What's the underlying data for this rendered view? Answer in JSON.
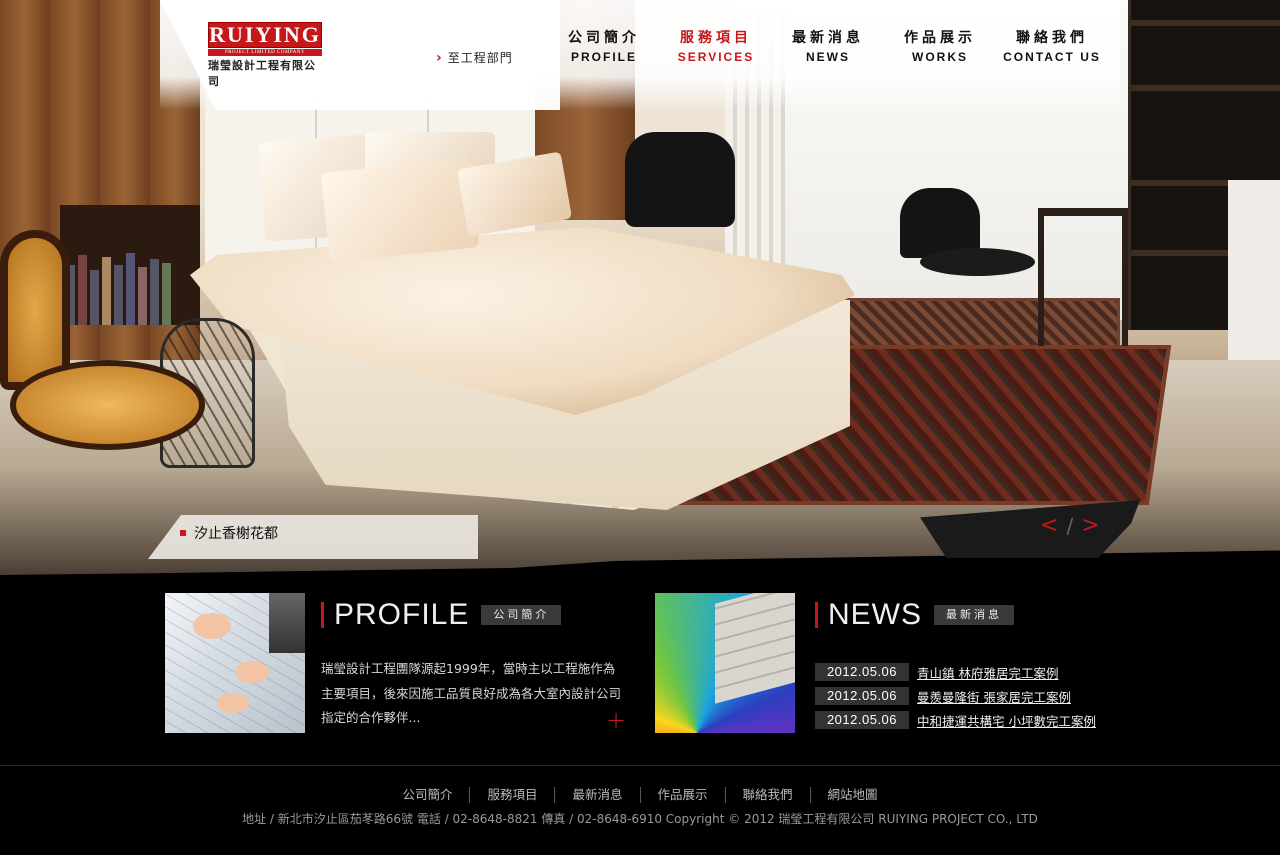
{
  "header": {
    "logo": {
      "mark": "RUIYING",
      "sub": "PROJECT LIMITED COMPANY",
      "cn": "瑞瑩設計工程有限公司"
    },
    "engineering_link": "至工程部門",
    "nav": [
      {
        "zh": "公司簡介",
        "en": "PROFILE",
        "active": false
      },
      {
        "zh": "服務項目",
        "en": "SERVICES",
        "active": true
      },
      {
        "zh": "最新消息",
        "en": "NEWS",
        "active": false
      },
      {
        "zh": "作品展示",
        "en": "WORKS",
        "active": false
      },
      {
        "zh": "聯絡我們",
        "en": "CONTACT US",
        "active": false
      }
    ]
  },
  "hero": {
    "caption": "汐止香榭花都",
    "prev": "<",
    "separator": "/",
    "next": ">"
  },
  "profile": {
    "title_en": "PROFILE",
    "title_badge": "公司簡介",
    "text": "瑞瑩設計工程團隊源起1999年，當時主以工程施作為主要項目，後來因施工品質良好成為各大室內設計公司指定的合作夥伴...",
    "more": "+"
  },
  "news": {
    "title_en": "NEWS",
    "title_badge": "最新消息",
    "items": [
      {
        "date": "2012.05.06",
        "title": "青山鎮 林府雅居完工案例"
      },
      {
        "date": "2012.05.06",
        "title": "曼羨曼隆街 張家居完工案例"
      },
      {
        "date": "2012.05.06",
        "title": "中和捷運共構宅 小坪數完工案例"
      }
    ]
  },
  "footer": {
    "links": [
      "公司簡介",
      "服務項目",
      "最新消息",
      "作品展示",
      "聯絡我們",
      "網站地圖"
    ],
    "info": "地址 / 新北市汐止區茄苳路66號 電話 / 02-8648-8821 傳真 / 02-8648-6910   Copyright © 2012 瑞瑩工程有限公司 RUIYING PROJECT CO., LTD"
  },
  "colors": {
    "accent": "#c6171a",
    "background": "#000000",
    "badge": "#3a3a3a"
  }
}
